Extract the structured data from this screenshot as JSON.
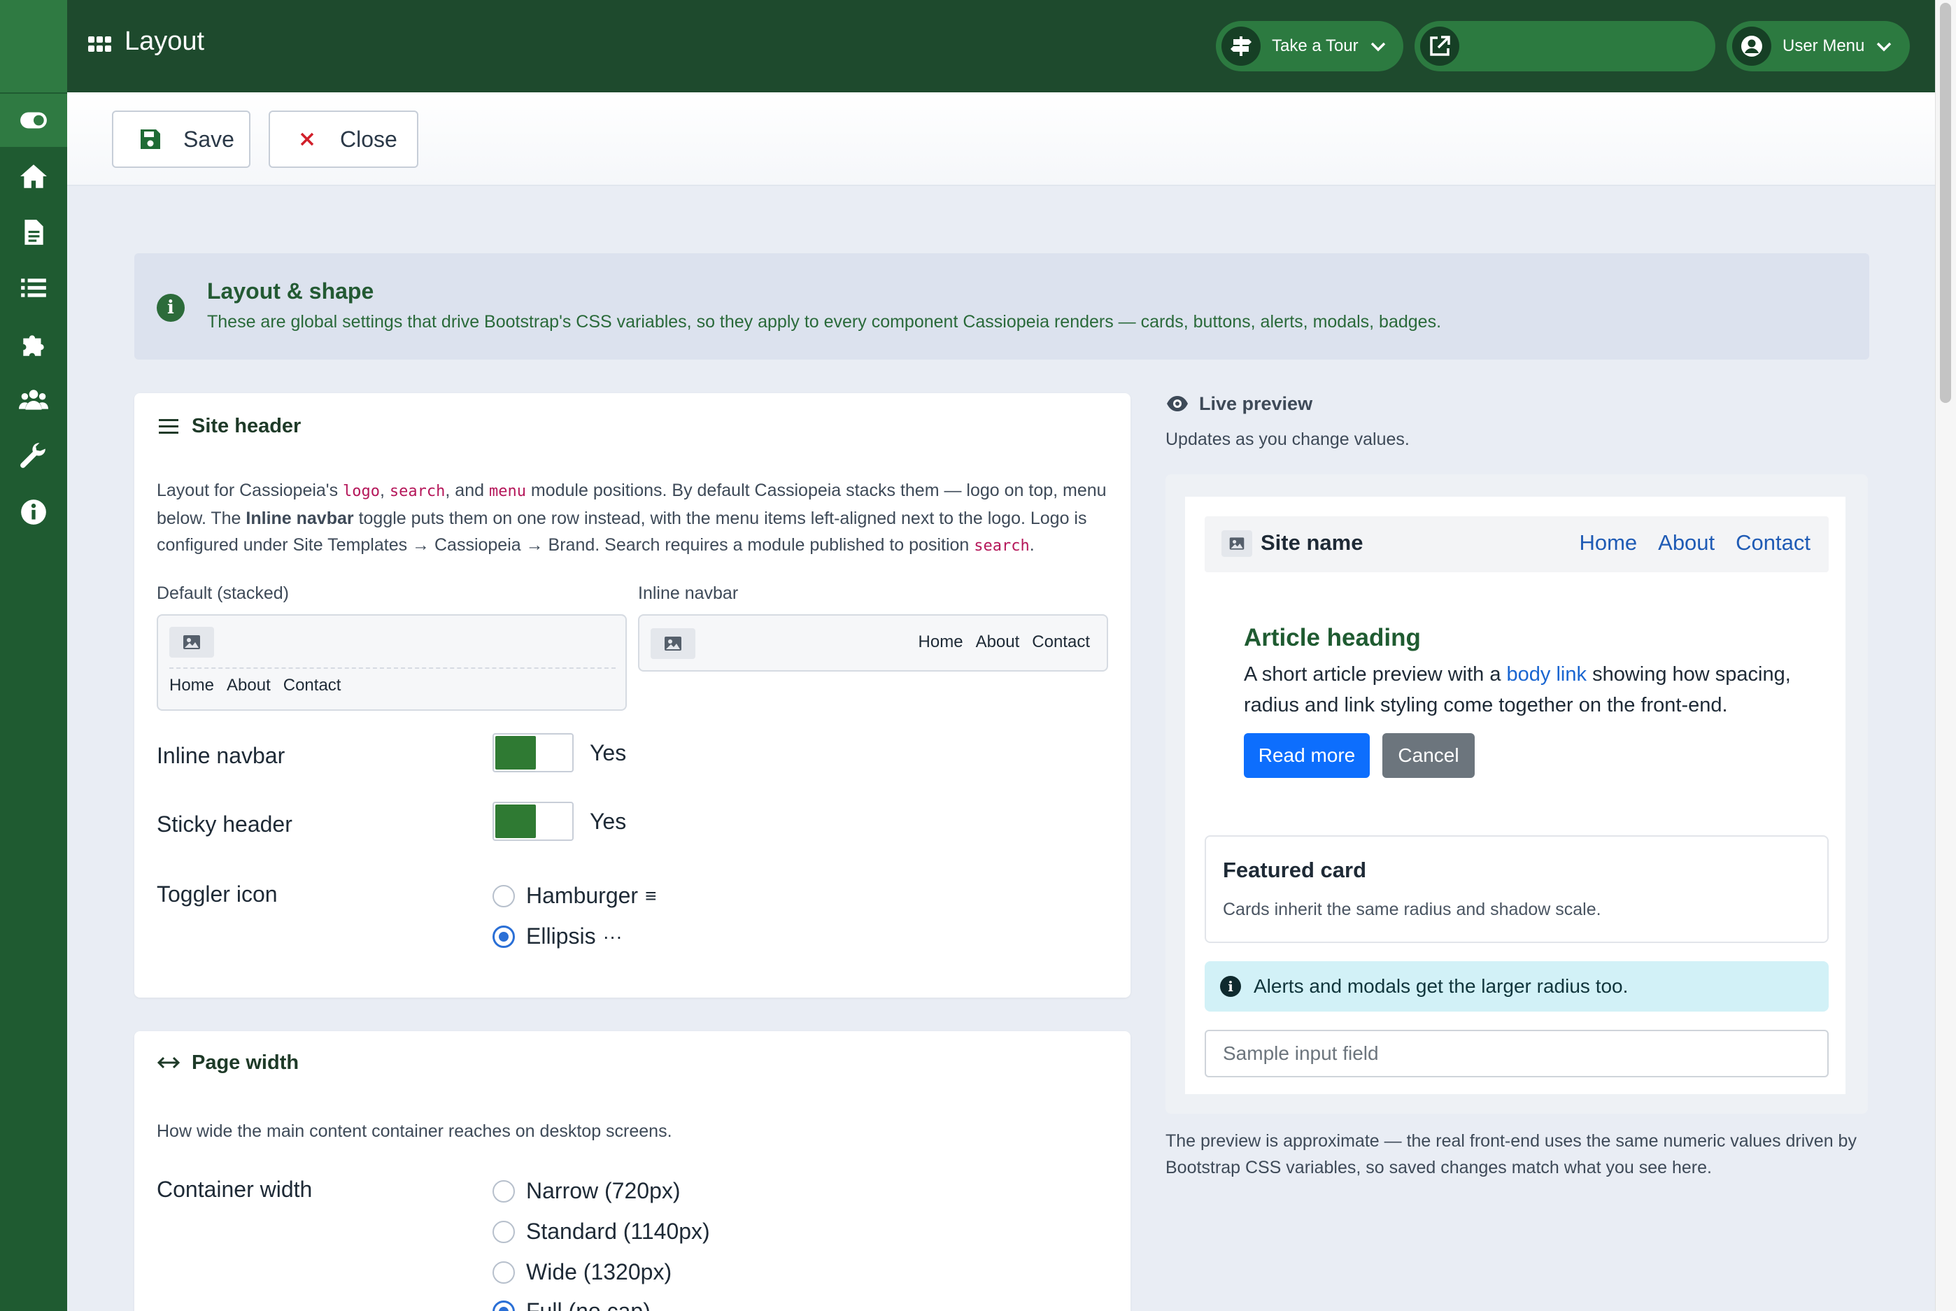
{
  "topbar": {
    "title": "Layout",
    "tour_label": "Take a Tour",
    "user_menu_label": "User Menu"
  },
  "sidebar": {
    "items": [
      {
        "icon": "toggle-icon",
        "active": true
      },
      {
        "icon": "home-icon"
      },
      {
        "icon": "file-icon"
      },
      {
        "icon": "list-icon"
      },
      {
        "icon": "puzzle-icon"
      },
      {
        "icon": "users-icon"
      },
      {
        "icon": "wrench-icon"
      },
      {
        "icon": "info-icon"
      }
    ]
  },
  "toolbar": {
    "save_label": "Save",
    "close_label": "Close"
  },
  "banner": {
    "title": "Layout & shape",
    "text": "These are global settings that drive Bootstrap's CSS variables, so they apply to every component Cassiopeia renders — cards, buttons, alerts, modals, badges."
  },
  "site_header": {
    "title": "Site header",
    "desc_1": "Layout for Cassiopeia's ",
    "code_logo": "logo",
    "desc_2": ", ",
    "code_search": "search",
    "desc_3": ", and ",
    "code_menu": "menu",
    "desc_4": " module positions. By default Cassiopeia stacks them — logo on top, menu below. The ",
    "desc_bold": "Inline navbar",
    "desc_5": " toggle puts them on one row instead, with the menu items left-aligned next to the logo. Logo is configured under Site Templates → Cassiopeia → Brand. Search requires a module published to position ",
    "code_search2": "search",
    "desc_6": ".",
    "default_label": "Default (stacked)",
    "inline_label": "Inline navbar",
    "nav_items": [
      "Home",
      "About",
      "Contact"
    ],
    "fields": {
      "inline_navbar": {
        "label": "Inline navbar",
        "value": "Yes"
      },
      "sticky_header": {
        "label": "Sticky header",
        "value": "Yes"
      },
      "toggler_icon": {
        "label": "Toggler icon",
        "options": [
          {
            "label": "Hamburger",
            "glyph": "≡",
            "selected": false
          },
          {
            "label": "Ellipsis",
            "glyph": "···",
            "selected": true
          }
        ]
      }
    }
  },
  "page_width": {
    "title": "Page width",
    "desc": "How wide the main content container reaches on desktop screens.",
    "container_label": "Container width",
    "options": [
      {
        "label": "Narrow (720px)",
        "selected": false
      },
      {
        "label": "Standard (1140px)",
        "selected": false
      },
      {
        "label": "Wide (1320px)",
        "selected": false
      },
      {
        "label": "Full (no cap)",
        "selected": true
      }
    ]
  },
  "preview": {
    "title": "Live preview",
    "subtitle": "Updates as you change values.",
    "site_name": "Site name",
    "nav_links": [
      "Home",
      "About",
      "Contact"
    ],
    "article_heading": "Article heading",
    "article_text_1": "A short article preview with a ",
    "article_link": "body link",
    "article_text_2": " showing how spacing, radius and link styling come together on the front-end.",
    "read_more": "Read more",
    "cancel": "Cancel",
    "card_title": "Featured card",
    "card_text": "Cards inherit the same radius and shadow scale.",
    "alert_text": "Alerts and modals get the larger radius too.",
    "input_placeholder": "Sample input field",
    "note": "The preview is approximate — the real front-end uses the same numeric values driven by Bootstrap CSS variables, so saved changes match what you see here."
  },
  "colors": {
    "sidebar": "#1f5b31",
    "topbar": "#1e4a2d",
    "accent_green": "#2f7a33",
    "primary_button": "#0d6efd",
    "secondary_button": "#6c757d",
    "alert_bg": "#d2f1f7"
  }
}
